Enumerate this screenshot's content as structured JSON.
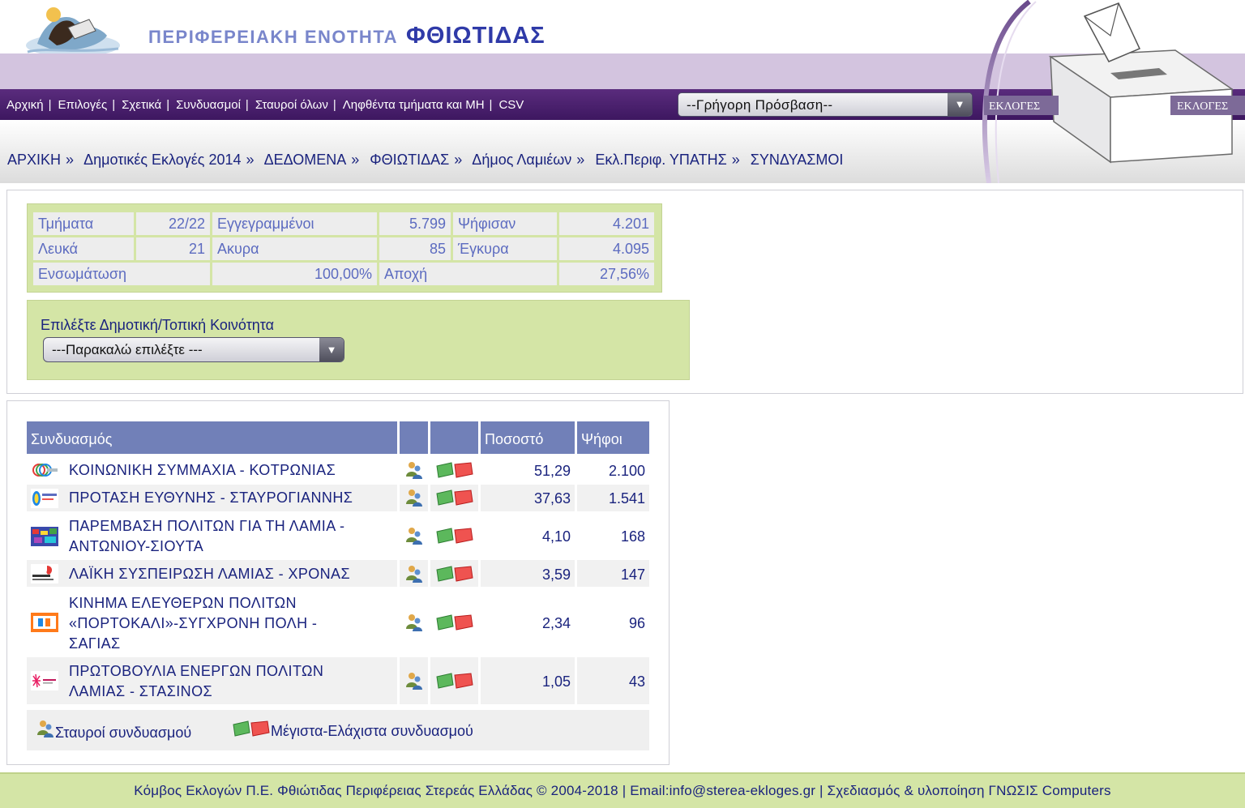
{
  "header": {
    "region_prefix": "ΠΕΡΙΦΕΡΕΙΑΚΗ ΕΝΟΤΗΤΑ",
    "region_name": "ΦΘΙΩΤΙΔΑΣ",
    "badge_left": "ΕΚΛΟΓΕΣ",
    "badge_right": "ΕΚΛΟΓΕΣ"
  },
  "nav": {
    "items": [
      "Αρχική",
      "Επιλογές",
      "Σχετικά",
      "Συνδυασμοί",
      "Σταυροί όλων",
      "Ληφθέντα τμήματα και ΜΗ",
      "CSV"
    ],
    "separator": "|"
  },
  "quick_access": {
    "selected": "--Γρήγορη Πρόσβαση--"
  },
  "breadcrumb": {
    "items": [
      "ΑΡΧΙΚΗ",
      "Δημοτικές Εκλογές 2014",
      "ΔΕΔΟΜΕΝΑ",
      "ΦΘΙΩΤΙΔΑΣ",
      "Δήμος Λαμιέων",
      "Εκλ.Περιφ. ΥΠΑΤΗΣ",
      "ΣΥΝΔΥΑΣΜΟΙ"
    ],
    "separator": "»"
  },
  "stats": {
    "sections_label": "Τμήματα",
    "sections_value": "22/22",
    "registered_label": "Εγγεγραμμένοι",
    "registered_value": "5.799",
    "voted_label": "Ψήφισαν",
    "voted_value": "4.201",
    "blank_label": "Λευκά",
    "blank_value": "21",
    "invalid_label": "Ακυρα",
    "invalid_value": "85",
    "valid_label": "Έγκυρα",
    "valid_value": "4.095",
    "integration_label": "Ενσωμάτωση",
    "integration_value": "100,00%",
    "abstention_label": "Αποχή",
    "abstention_value": "27,56%"
  },
  "community_select": {
    "label": "Επιλέξτε Δημοτική/Τοπική Κοινότητα",
    "selected": "---Παρακαλώ επιλέξτε ---"
  },
  "results": {
    "headers": {
      "party": "Συνδυασμός",
      "percent": "Ποσοστό",
      "votes": "Ψήφοι"
    },
    "rows": [
      {
        "name": "ΚΟΙΝΩΝΙΚΗ ΣΥΜΜΑΧΙΑ - ΚΟΤΡΩΝΙΑΣ",
        "percent": "51,29",
        "votes": "2.100"
      },
      {
        "name": "ΠΡΟΤΑΣΗ ΕΥΘΥΝΗΣ - ΣΤΑΥΡΟΓΙΑΝΝΗΣ",
        "percent": "37,63",
        "votes": "1.541"
      },
      {
        "name": "ΠΑΡΕΜΒΑΣΗ ΠΟΛΙΤΩΝ ΓΙΑ ΤΗ ΛΑΜΙΑ - ΑΝΤΩΝΙΟΥ-ΣΙΟΥΤΑ",
        "percent": "4,10",
        "votes": "168"
      },
      {
        "name": "ΛΑΪΚΗ ΣΥΣΠΕΙΡΩΣΗ ΛΑΜΙΑΣ - ΧΡΟΝΑΣ",
        "percent": "3,59",
        "votes": "147"
      },
      {
        "name": "ΚΙΝΗΜΑ ΕΛΕΥΘΕΡΩΝ ΠΟΛΙΤΩΝ «ΠΟΡΤΟΚΑΛΙ»-ΣΥΓΧΡΟΝΗ ΠΟΛΗ - ΣΑΓΙΑΣ",
        "percent": "2,34",
        "votes": "96"
      },
      {
        "name": "ΠΡΩΤΟΒΟΥΛΙΑ ΕΝΕΡΓΩΝ ΠΟΛΙΤΩΝ ΛΑΜΙΑΣ - ΣΤΑΣΙΝΟΣ",
        "percent": "1,05",
        "votes": "43"
      }
    ]
  },
  "legend": {
    "crosses_label": "Σταυροί συνδυασμού",
    "minmax_label": "Μέγιστα-Ελάχιστα συνδυασμού"
  },
  "footer": {
    "text": "Κόμβος Εκλογών Π.Ε. Φθιώτιδας Περιφέρειας Στερεάς Ελλάδας © 2004-2018 | Email:info@sterea-ekloges.gr | Σχεδιασμός & υλοποίηση ΓΝΩΣΙΣ Computers"
  },
  "colors": {
    "nav_purple": "#4a1f6e",
    "lilac_band": "#d3c4df",
    "panel_green": "#d4e5a6",
    "table_header_blue": "#7180b8",
    "link_navy": "#1a237e",
    "stat_text": "#5c6bc0"
  }
}
